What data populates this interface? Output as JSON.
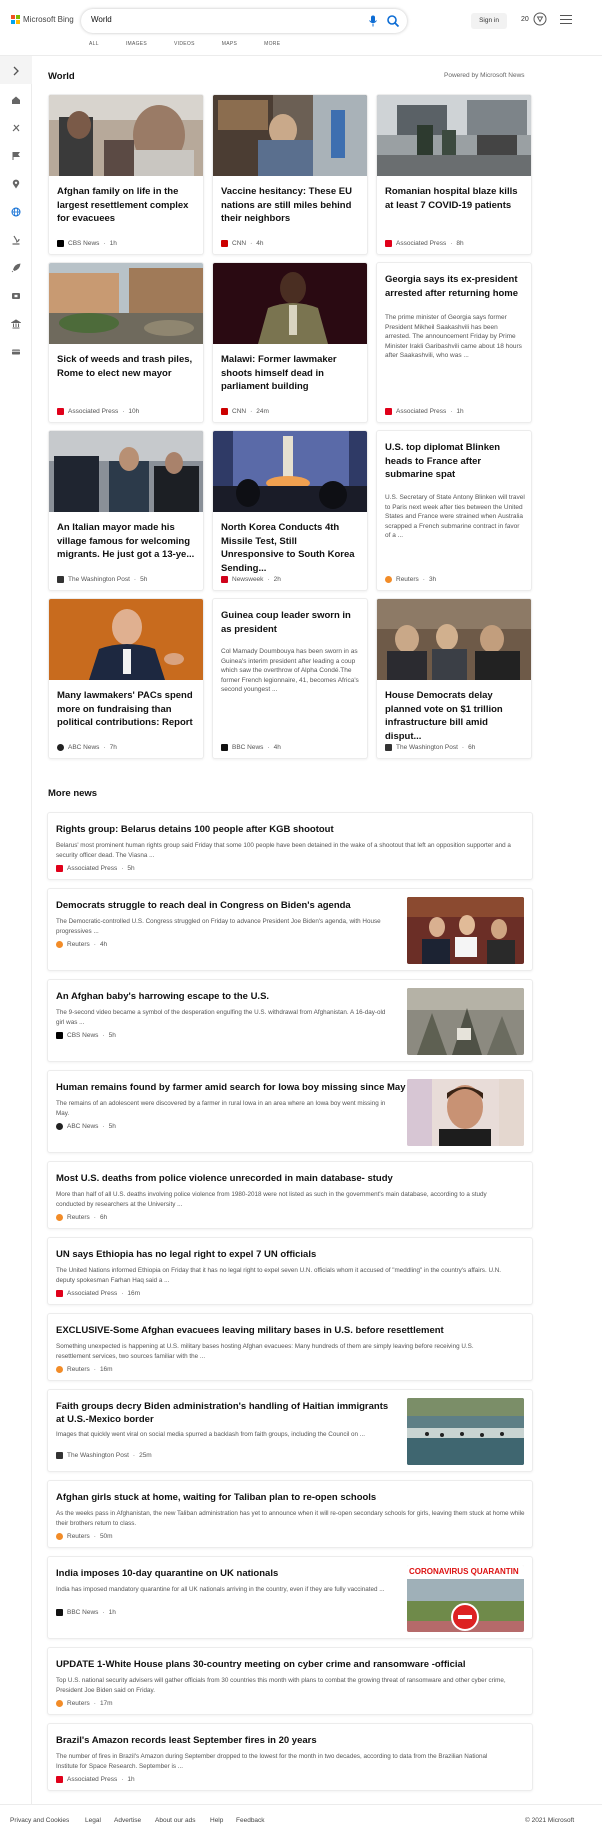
{
  "header": {
    "logo_text": "Microsoft Bing",
    "search_value": "World",
    "scopes": [
      "ALL",
      "IMAGES",
      "VIDEOS",
      "MAPS",
      "MORE"
    ],
    "signin_label": "Sign in",
    "rewards_count": "20"
  },
  "sidebar": {
    "items": [
      "expand-icon",
      "home-icon",
      "tools-icon",
      "flag-icon",
      "location-icon",
      "globe-icon",
      "microscope-icon",
      "rocket-icon",
      "entertainment-icon",
      "bank-icon",
      "money-icon"
    ]
  },
  "section": {
    "title": "World",
    "powered_by": "Powered by Microsoft News"
  },
  "cards": [
    {
      "title": "Afghan family on life in the largest resettlement complex for evacuees",
      "source": "CBS News",
      "time": "1h",
      "color": "#000000"
    },
    {
      "title": "Vaccine hesitancy: These EU nations are still miles behind their neighbors",
      "source": "CNN",
      "time": "4h",
      "color": "#cc0000"
    },
    {
      "title": "Romanian hospital blaze kills at least 7 COVID-19 patients",
      "source": "Associated Press",
      "time": "8h",
      "color": "#e0001a"
    },
    {
      "title": "Sick of weeds and trash piles, Rome to elect new mayor",
      "source": "Associated Press",
      "time": "10h",
      "color": "#e0001a"
    },
    {
      "title": "Malawi: Former lawmaker shoots himself dead in parliament building",
      "source": "CNN",
      "time": "24m",
      "color": "#cc0000"
    },
    {
      "title": "Georgia says its ex-president arrested after returning home",
      "snippet": "The prime minister of Georgia says former President Mikheil Saakashvili has been arrested. The announcement Friday by Prime Minister Irakli Garibashvili came about 18 hours after Saakashvili, who was ...",
      "source": "Associated Press",
      "time": "1h",
      "color": "#e0001a"
    },
    {
      "title": "An Italian mayor made his village famous for welcoming migrants. He just got a 13-ye...",
      "source": "The Washington Post",
      "time": "5h",
      "color": "#333333"
    },
    {
      "title": "North Korea Conducts 4th Missile Test, Still Unresponsive to South Korea Sending...",
      "source": "Newsweek",
      "time": "2h",
      "color": "#d0021b"
    },
    {
      "title": "U.S. top diplomat Blinken heads to France after submarine spat",
      "snippet": "U.S. Secretary of State Antony Blinken will travel to Paris next week after ties between the United States and France were strained when Australia scrapped a French submarine contract in favor of a ...",
      "source": "Reuters",
      "time": "3h",
      "color": "#f28c28"
    },
    {
      "title": "Many lawmakers' PACs spend more on fundraising than political contributions: Report",
      "source": "ABC News",
      "time": "7h",
      "color": "#222222"
    },
    {
      "title": "Guinea coup leader sworn in as president",
      "snippet": "Col Mamady Doumbouya has been sworn in as Guinea's interim president after leading a coup which saw the overthrow of Alpha Condé.The former French legionnaire, 41, becomes Africa's second youngest ...",
      "source": "BBC News",
      "time": "4h",
      "color": "#111111"
    },
    {
      "title": "House Democrats delay planned vote on $1 trillion infrastructure bill amid disput...",
      "source": "The Washington Post",
      "time": "6h",
      "color": "#333333"
    }
  ],
  "more_news": {
    "title": "More news",
    "items": [
      {
        "title": "Rights group: Belarus detains 100 people after KGB shootout",
        "snippet": "Belarus' most prominent human rights group said Friday that some 100 people have been detained in the wake of a shootout that left an opposition supporter and a security officer dead. The Viasna ...",
        "source": "Associated Press",
        "time": "5h",
        "color": "#e0001a"
      },
      {
        "title": "Democrats struggle to reach deal in Congress on Biden's agenda",
        "snippet": "The Democratic-controlled U.S. Congress struggled on Friday to advance President Joe Biden's agenda, with House progressives ...",
        "source": "Reuters",
        "time": "4h",
        "color": "#f28c28"
      },
      {
        "title": "An Afghan baby's harrowing escape to the U.S.",
        "snippet": "The 9-second video became a symbol of the desperation engulfing the U.S. withdrawal from Afghanistan. A 16-day-old girl was ...",
        "source": "CBS News",
        "time": "5h",
        "color": "#000000"
      },
      {
        "title": "Human remains found by farmer amid search for Iowa boy missing since May",
        "snippet": "The remains of an adolescent were discovered by a farmer in rural Iowa in an area where an Iowa boy went missing in May.",
        "source": "ABC News",
        "time": "5h",
        "color": "#222222"
      },
      {
        "title": "Most U.S. deaths from police violence unrecorded in main database- study",
        "snippet": "More than half of all U.S. deaths involving police violence from 1980-2018 were not listed as such in the government's main database, according to a study conducted by researchers at the University ...",
        "source": "Reuters",
        "time": "6h",
        "color": "#f28c28"
      },
      {
        "title": "UN says Ethiopia has no legal right to expel 7 UN officials",
        "snippet": "The United Nations informed Ethiopia on Friday that it has no legal right to expel seven U.N. officials whom it accused of \"meddling\" in the country's affairs. U.N. deputy spokesman Farhan Haq said a ...",
        "source": "Associated Press",
        "time": "16m",
        "color": "#e0001a"
      },
      {
        "title": "EXCLUSIVE-Some Afghan evacuees leaving military bases in U.S. before resettlement",
        "snippet": "Something unexpected is happening at U.S. military bases hosting Afghan evacuees: Many hundreds of them are simply leaving before receiving U.S. resettlement services, two sources familiar with the ...",
        "source": "Reuters",
        "time": "16m",
        "color": "#f28c28"
      },
      {
        "title": "Faith groups decry Biden administration's handling of Haitian immigrants at U.S.-Mexico border",
        "snippet": "Images that quickly went viral on social media spurred a backlash from faith groups, including the Council on ...",
        "source": "The Washington Post",
        "time": "25m",
        "color": "#333333"
      },
      {
        "title": "Afghan girls stuck at home, waiting for Taliban plan to re-open schools",
        "snippet": "As the weeks pass in Afghanistan, the new Taliban administration has yet to announce when it will re-open secondary schools for girls, leaving them stuck at home while their brothers return to class.",
        "source": "Reuters",
        "time": "50m",
        "color": "#f28c28"
      },
      {
        "title": "India imposes 10-day quarantine on UK nationals",
        "snippet": "India has imposed mandatory quarantine for all UK nationals arriving in the country, even if they are fully vaccinated ...",
        "source": "BBC News",
        "time": "1h",
        "color": "#111111",
        "image_text": "CORONAVIRUS QUARANTIN"
      },
      {
        "title": "UPDATE 1-White House plans 30-country meeting on cyber crime and ransomware -official",
        "snippet": "Top U.S. national security advisers will gather officials from 30 countries this month with plans to combat the growing threat of ransomware and other cyber crime, President Joe Biden said on Friday.",
        "source": "Reuters",
        "time": "17m",
        "color": "#f28c28"
      },
      {
        "title": "Brazil's Amazon records least September fires in 20 years",
        "snippet": "The number of fires in Brazil's Amazon during September dropped to the lowest for the month in two decades, according to data from the Brazilian National Institute for Space Research. September is ...",
        "source": "Associated Press",
        "time": "1h",
        "color": "#e0001a"
      }
    ]
  },
  "footer": {
    "links": [
      "Privacy and Cookies",
      "Legal",
      "Advertise",
      "About our ads",
      "Help",
      "Feedback"
    ],
    "copyright": "© 2021 Microsoft"
  }
}
